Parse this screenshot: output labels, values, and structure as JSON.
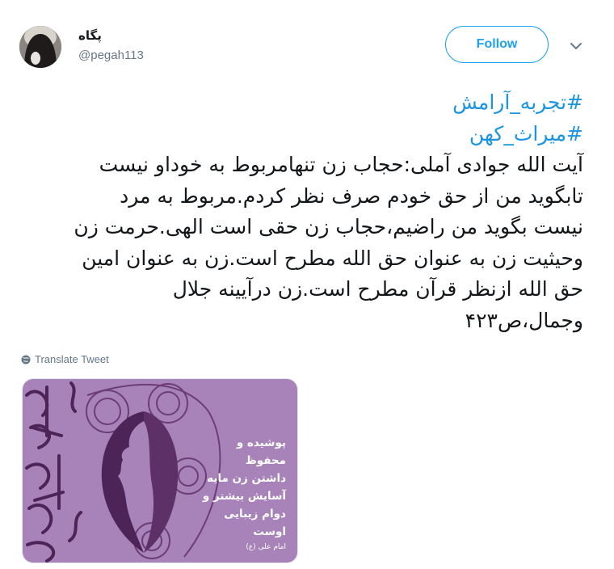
{
  "user": {
    "display_name": "پگاه",
    "handle": "@pegah113"
  },
  "actions": {
    "follow_label": "Follow",
    "more_icon": "chevron-down-icon"
  },
  "tweet": {
    "hashtags": [
      "#تجربه_آرامش",
      "#میراث_کهن"
    ],
    "lines": [
      "آیت الله جوادی آملی:حجاب زن تنهامربوط به خوداو نیست",
      "تابگوید من از حق خودم صرف نظر کردم.مربوط به مرد",
      "نیست بگوید من راضیم،حجاب زن حقی است الهی.حرمت زن",
      "وحیثیت زن به عنوان حق الله مطرح است.زن به عنوان امین",
      "حق الله ازنظر قرآن مطرح است.زن درآیینه جلال",
      "وجمال،ص۴۲۳"
    ]
  },
  "translate": {
    "label": "Translate Tweet",
    "icon": "globe-icon"
  },
  "media": {
    "caption_lines": [
      "پوشیده و محفوظ",
      "داشتن زن  مایه",
      "آسایش بیشتر و",
      "دوام زیبایی اوست"
    ],
    "attribution": "امام علی (ع)",
    "colors": {
      "bg": "#a883b9",
      "dark": "#4d2458"
    }
  }
}
